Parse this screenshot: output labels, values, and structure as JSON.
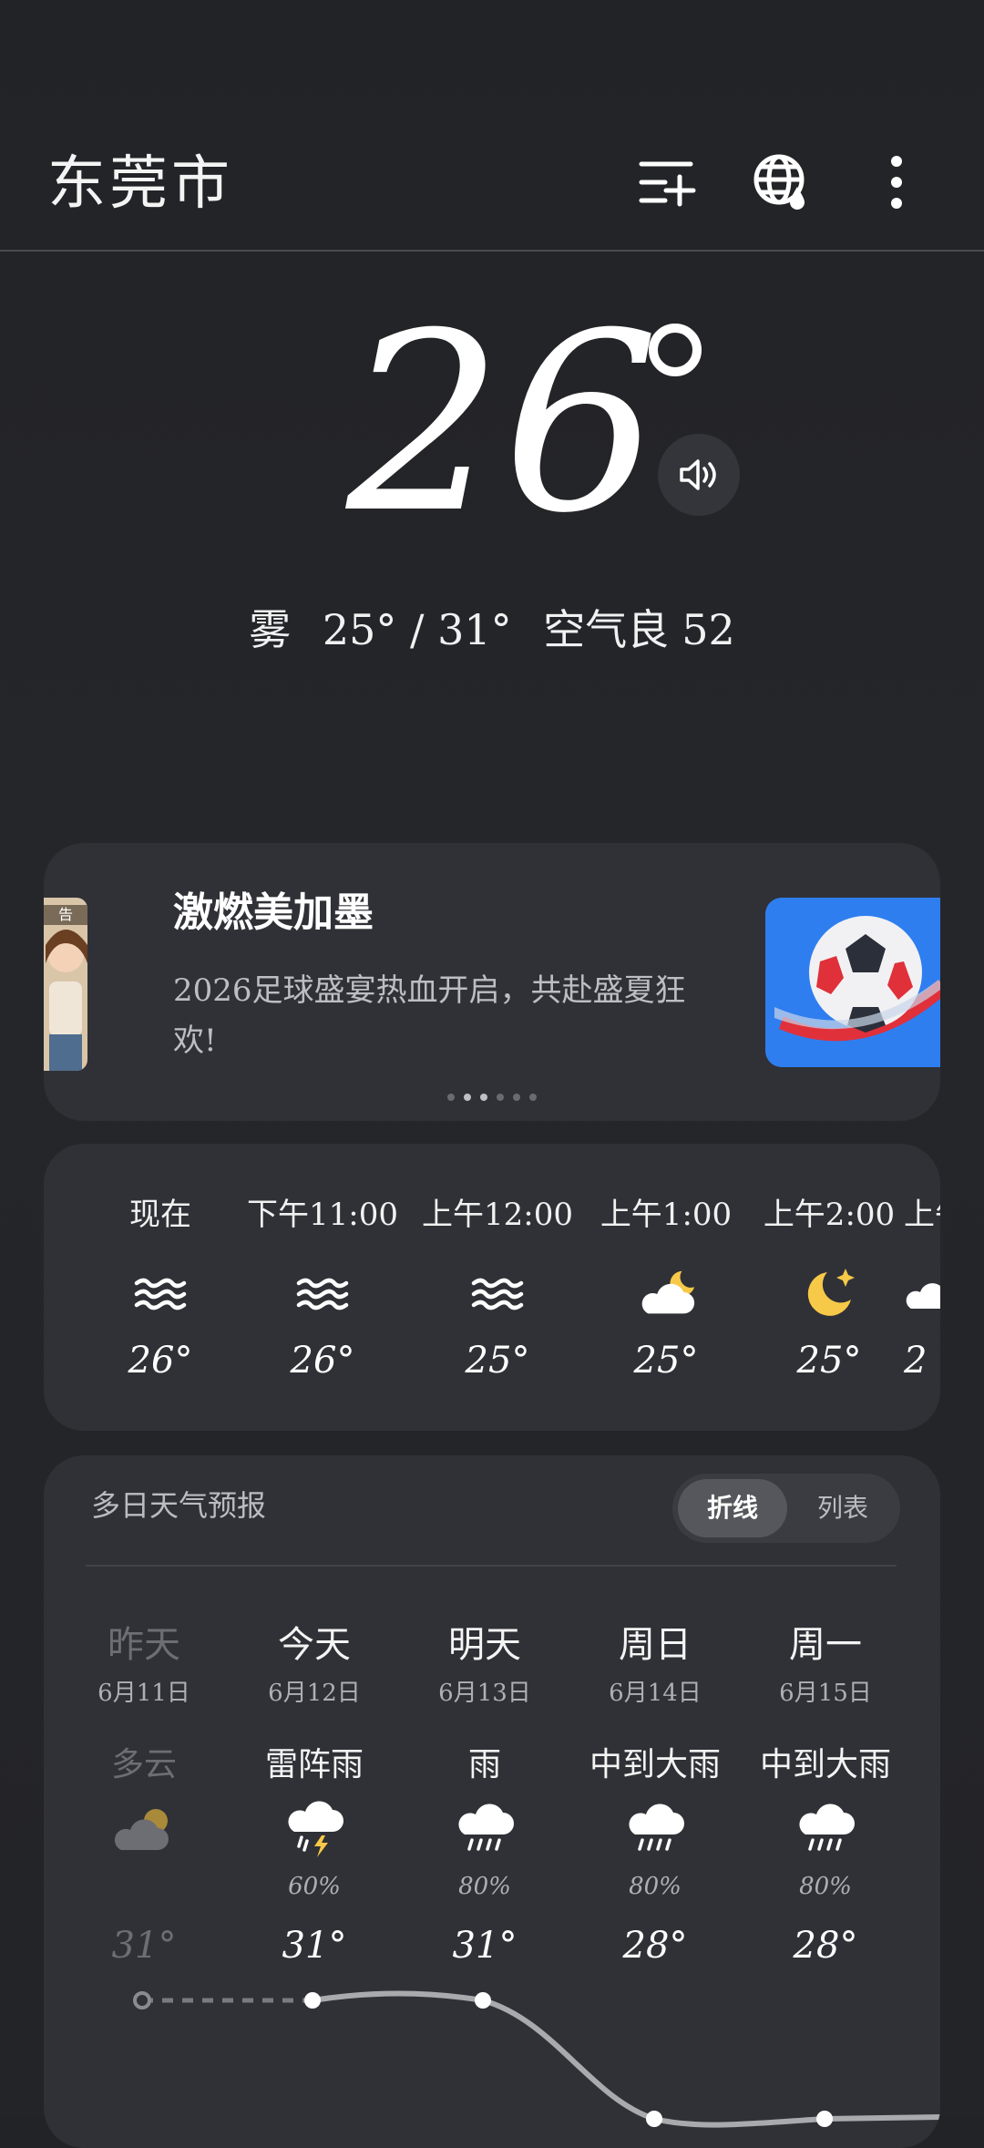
{
  "header": {
    "city": "东莞市"
  },
  "current": {
    "temp": "26",
    "condition": "雾",
    "range": "25° / 31°",
    "air_label": "空气良",
    "aqi": "52"
  },
  "ad": {
    "tag": "告",
    "title": "激燃美加墨",
    "desc": "2026足球盛宴热血开启，共赴盛夏狂欢!"
  },
  "hourly": [
    {
      "time": "现在",
      "icon": "fog-icon",
      "temp": "26°"
    },
    {
      "time": "下午11:00",
      "icon": "fog-icon",
      "temp": "26°"
    },
    {
      "time": "上午12:00",
      "icon": "fog-icon",
      "temp": "25°"
    },
    {
      "time": "上午1:00",
      "icon": "cloudy-night-icon",
      "temp": "25°"
    },
    {
      "time": "上午2:00",
      "icon": "clear-night-icon",
      "temp": "25°"
    },
    {
      "time": "上午",
      "icon": "cloud-icon",
      "temp": "2"
    }
  ],
  "daily": {
    "title": "多日天气预报",
    "toggle": {
      "line": "折线",
      "list": "列表"
    },
    "days": [
      {
        "day": "昨天",
        "date": "6月11日",
        "cond": "多云",
        "icon": "partly-cloudy-icon",
        "pct": "",
        "high": "31°"
      },
      {
        "day": "今天",
        "date": "6月12日",
        "cond": "雷阵雨",
        "icon": "thunder-rain-icon",
        "pct": "60%",
        "high": "31°"
      },
      {
        "day": "明天",
        "date": "6月13日",
        "cond": "雨",
        "icon": "rain-icon",
        "pct": "80%",
        "high": "31°"
      },
      {
        "day": "周日",
        "date": "6月14日",
        "cond": "中到大雨",
        "icon": "rain-icon",
        "pct": "80%",
        "high": "28°"
      },
      {
        "day": "周一",
        "date": "6月15日",
        "cond": "中到大雨",
        "icon": "rain-icon",
        "pct": "80%",
        "high": "28°"
      }
    ]
  },
  "colors": {
    "bg": "#232428",
    "card": "#303136",
    "accent_moon": "#f7c948",
    "ad_blue": "#2f7ef0"
  }
}
